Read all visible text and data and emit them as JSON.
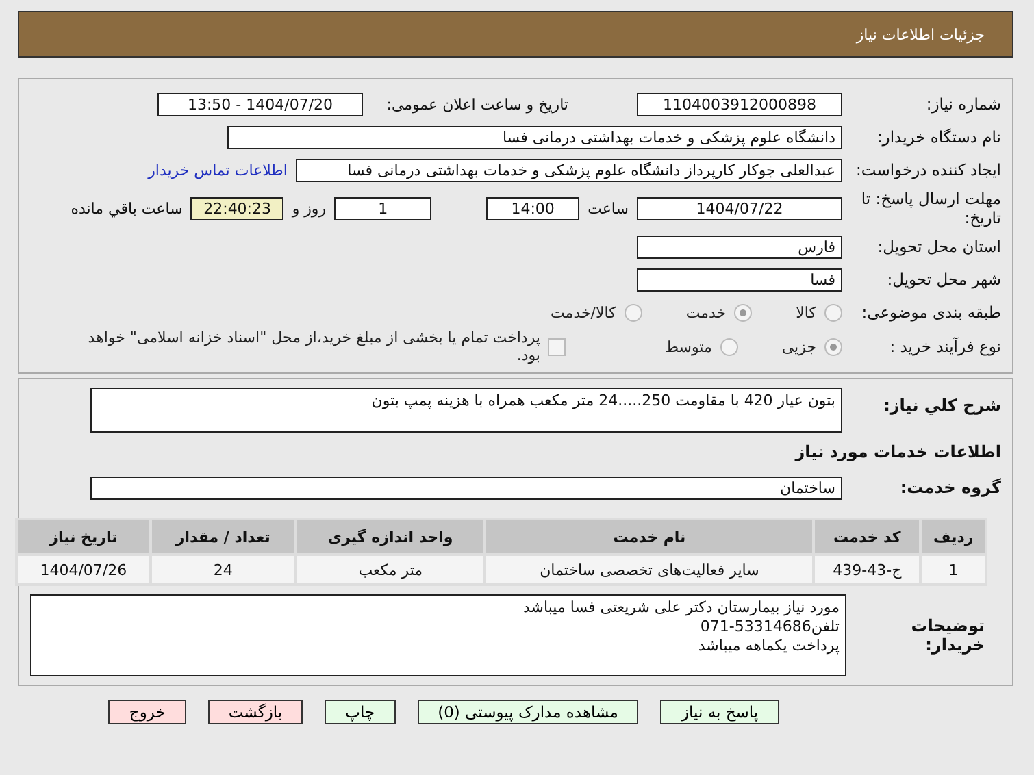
{
  "header": {
    "title": "جزئیات اطلاعات نیاز"
  },
  "need_number": {
    "label": "شماره نیاز:",
    "value": "1104003912000898"
  },
  "announce": {
    "label": "تاریخ و ساعت اعلان عمومی:",
    "value": "1404/07/20 - 13:50"
  },
  "buyer": {
    "label": "نام دستگاه خریدار:",
    "value": "دانشگاه علوم پزشکی و خدمات بهداشتی درمانی فسا"
  },
  "requester": {
    "label": "ایجاد کننده درخواست:",
    "value": "عبدالعلی جوکار کارپرداز دانشگاه علوم پزشکی و خدمات بهداشتی درمانی فسا",
    "link": "اطلاعات تماس خریدار"
  },
  "deadline": {
    "label": "مهلت ارسال پاسخ: تا تاریخ:",
    "date": "1404/07/22",
    "time_label": "ساعت",
    "time": "14:00",
    "days": "1",
    "days_label": "روز و",
    "remaining": "22:40:23",
    "remaining_label": "ساعت باقي مانده"
  },
  "province": {
    "label": "استان محل تحویل:",
    "value": "فارس"
  },
  "city": {
    "label": "شهر محل تحویل:",
    "value": "فسا"
  },
  "category": {
    "label": "طبقه بندی موضوعی:",
    "options": [
      {
        "label": "کالا",
        "selected": false
      },
      {
        "label": "خدمت",
        "selected": true
      },
      {
        "label": "کالا/خدمت",
        "selected": false
      }
    ]
  },
  "purchase_type": {
    "label": "نوع فرآیند خرید :",
    "options": [
      {
        "label": "جزیی",
        "selected": true
      },
      {
        "label": "متوسط",
        "selected": false
      }
    ],
    "payment": {
      "label": "پرداخت تمام یا بخشی از مبلغ خرید،از محل \"اسناد خزانه اسلامی\" خواهد بود.",
      "checked": false
    }
  },
  "description": {
    "label": "شرح کلي نیاز:",
    "value": "بتون عیار 420 با مقاومت 250.....24 متر مکعب همراه با هزینه پمپ بتون"
  },
  "services_title": "اطلاعات خدمات مورد نیاز",
  "service_group": {
    "label": "گروه خدمت:",
    "value": "ساختمان"
  },
  "table": {
    "columns": [
      "ردیف",
      "کد خدمت",
      "نام خدمت",
      "واحد اندازه گیری",
      "تعداد / مقدار",
      "تاریخ نیاز"
    ],
    "rows": [
      [
        "1",
        "ج-43-439",
        "سایر فعالیت‌های تخصصی ساختمان",
        "متر مکعب",
        "24",
        "1404/07/26"
      ]
    ]
  },
  "buyer_notes": {
    "label": "توضیحات خریدار:",
    "lines": [
      "مورد نیاز بیمارستان دکتر علی شریعتی فسا میباشد",
      "تلفن53314686-071",
      "پرداخت یکماهه میباشد"
    ]
  },
  "buttons": [
    {
      "label": "پاسخ به نیاز",
      "kind": "action"
    },
    {
      "label": "مشاهده مدارک پیوستی (0)",
      "kind": "action"
    },
    {
      "label": "چاپ",
      "kind": "action"
    },
    {
      "label": "بازگشت",
      "kind": "danger"
    },
    {
      "label": "خروج",
      "kind": "danger"
    }
  ]
}
